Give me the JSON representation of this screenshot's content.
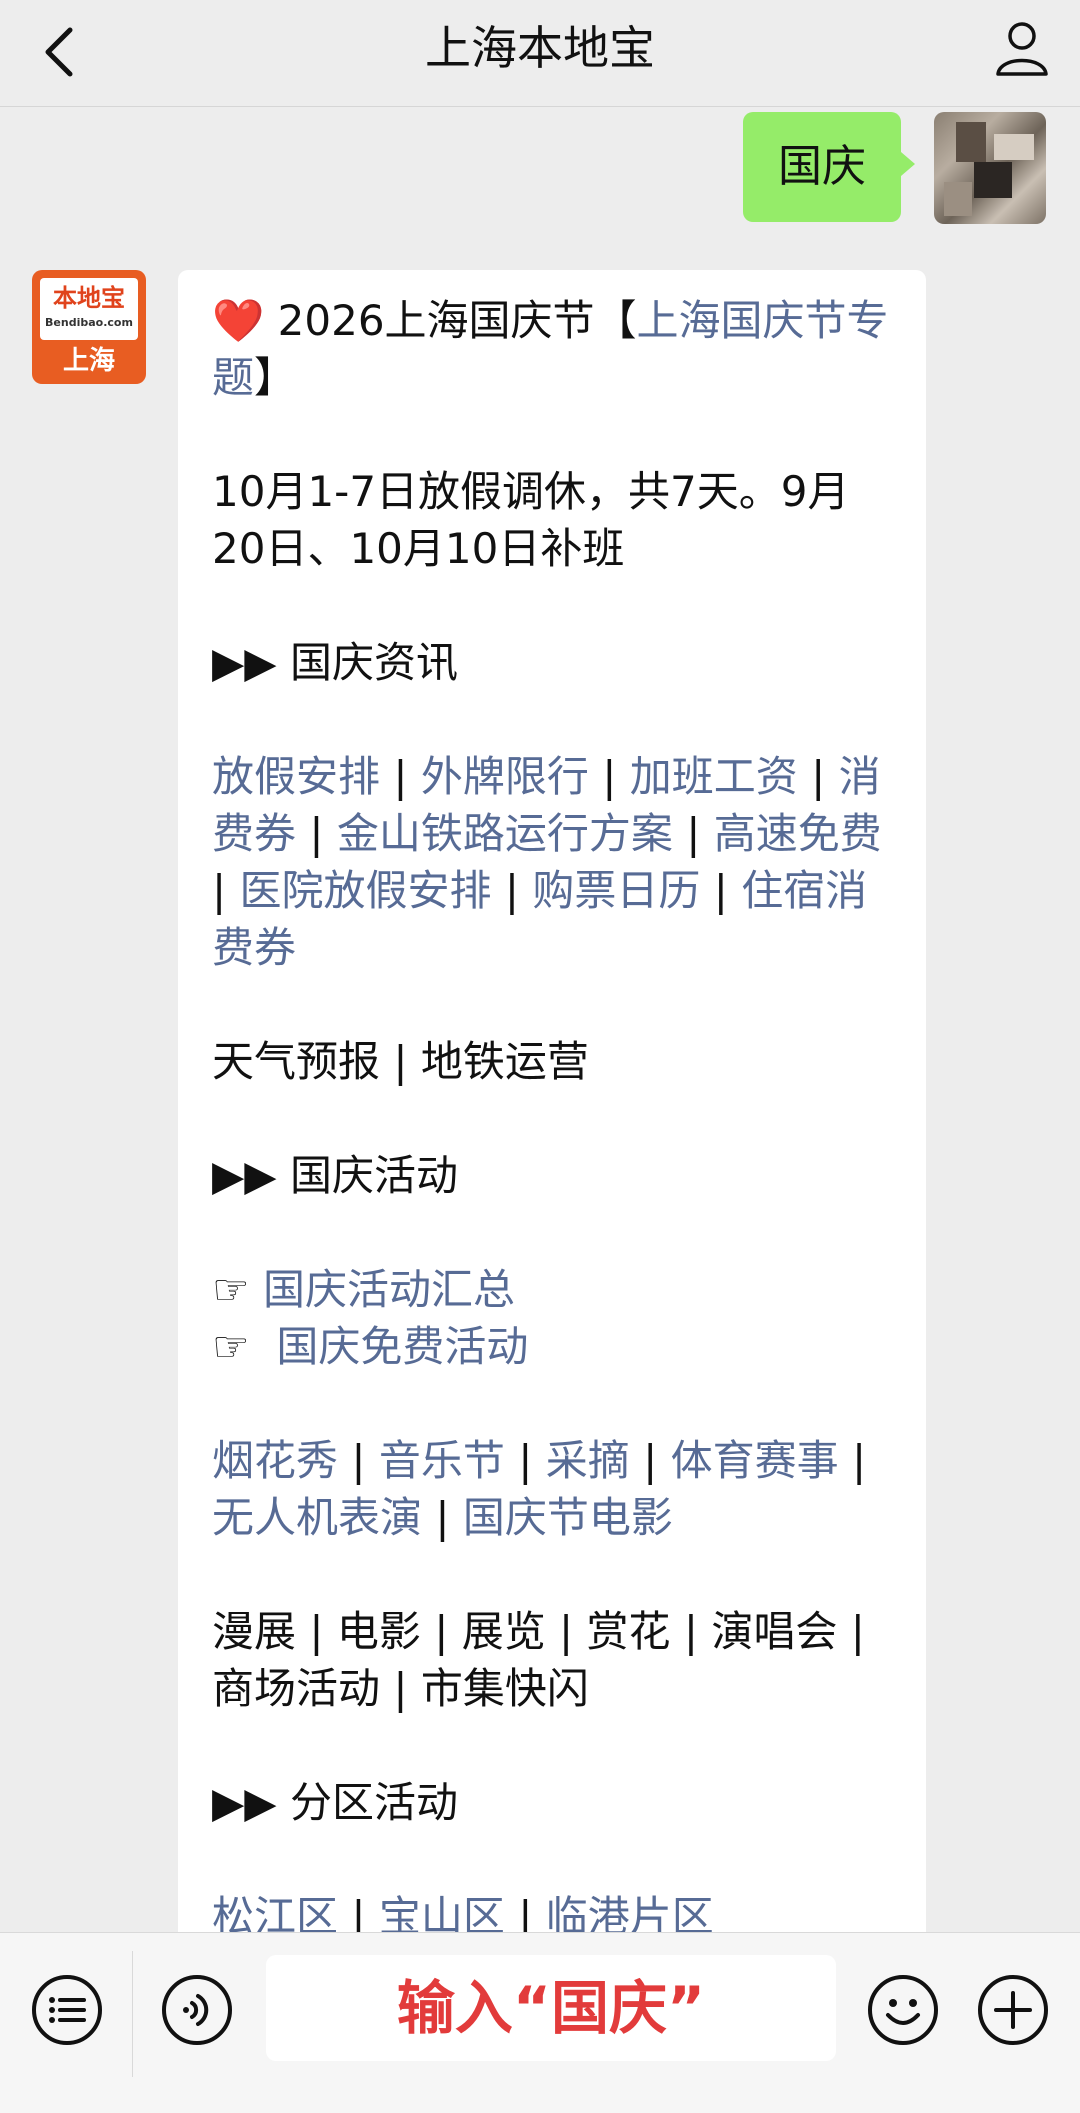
{
  "header": {
    "title": "上海本地宝"
  },
  "user_message": {
    "text": "国庆"
  },
  "bot_avatar": {
    "brand": "本地宝",
    "domain": "Bendibao.com",
    "city": "上海"
  },
  "bot_message": {
    "heart": "❤️",
    "title_text": " 2026上海国庆节【",
    "title_link": "上海国庆节专题",
    "title_end": "】",
    "notice": "10月1-7日放假调休，共7天。9月20日、10月10日补班",
    "section1": "▶▶ 国庆资讯",
    "info_links": [
      "放假安排",
      "外牌限行",
      "加班工资",
      "消费券",
      "金山铁路运行方案",
      "高速免费",
      "医院放假安排",
      "购票日历",
      "住宿消费券"
    ],
    "plain_line1": "天气预报 | 地铁运营",
    "section2": "▶▶ 国庆活动",
    "pointer_links": [
      {
        "icon": "☞",
        "label": "国庆活动汇总"
      },
      {
        "icon": "☞",
        "label": "国庆免费活动"
      }
    ],
    "activity_links": [
      "烟花秀",
      "音乐节",
      "采摘",
      "体育赛事",
      "无人机表演",
      "国庆节电影"
    ],
    "plain_line2": "漫展 | 电影 | 展览 | 赏花 | 演唱会 | 商场活动 | 市集快闪",
    "section3": "▶▶ 分区活动",
    "district_links": [
      "松江区",
      "宝山区",
      "临港片区"
    ]
  },
  "input_bar": {
    "text": "输入“国庆”"
  }
}
